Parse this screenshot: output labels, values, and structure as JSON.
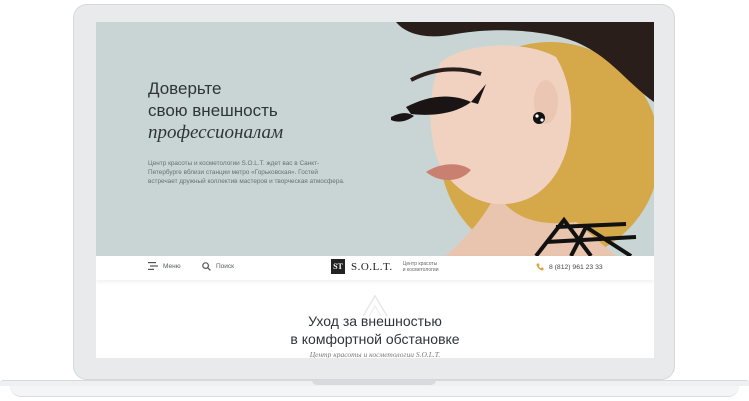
{
  "hero": {
    "title_line1": "Доверьте",
    "title_line2": "свою внешность",
    "title_line3": "профессионалам",
    "description": "Центр красоты и косметологии S.O.L.T. ждет вас в Санкт-Петербурге вблизи станции метро «Горьковская». Гостей встречает дружный коллектив мастеров и творческая атмосфера."
  },
  "nav": {
    "menu_label": "Меню",
    "search_label": "Поиск",
    "logo_mark": "ST",
    "logo_word": "S.O.L.T.",
    "logo_sub_line1": "Центр красоты",
    "logo_sub_line2": "и косметологии",
    "phone": "8 (812) 961 23 33"
  },
  "section": {
    "title_line1": "Уход за внешностью",
    "title_line2": "в комфортной обстановке",
    "subtitle": "Центр красоты и косметологии S.O.L.T."
  },
  "colors": {
    "hero_bg": "#c9d5d4",
    "accent_circle": "#d5a84a",
    "phone_icon": "#e0a040"
  },
  "icons": [
    "menu-icon",
    "search-icon",
    "phone-icon"
  ]
}
